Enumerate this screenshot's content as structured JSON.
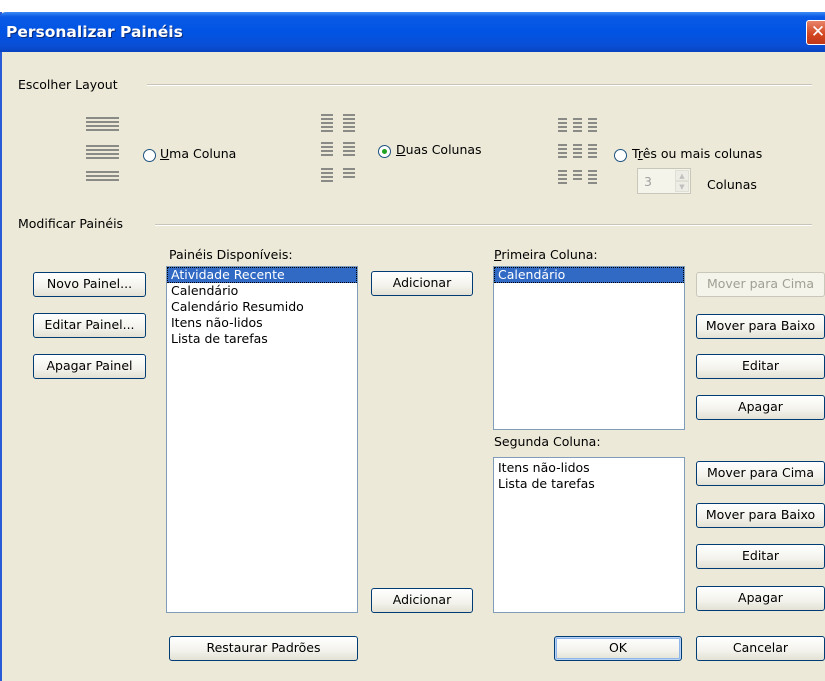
{
  "window": {
    "title": "Personalizar Painéis",
    "close_glyph": "✕"
  },
  "layout_group": {
    "label": "Escolher Layout",
    "options": [
      {
        "key": "U",
        "rest": "ma Coluna",
        "checked": false
      },
      {
        "key": "D",
        "rest": "uas Colunas",
        "checked": true
      },
      {
        "pre": "T",
        "key": "r",
        "rest": "ês ou mais colunas",
        "checked": false
      }
    ],
    "columns_spin": {
      "value": "3",
      "label": "Colunas"
    }
  },
  "panels_group": {
    "label": "Modificar Painéis",
    "left_buttons": {
      "new": "Novo Painel...",
      "edit": "Editar Painel...",
      "delete": "Apagar Painel"
    },
    "available": {
      "label": "Painéis Disponíveis:",
      "items": [
        "Atividade Recente",
        "Calendário",
        "Calendário Resumido",
        "Itens não-lidos",
        "Lista de tarefas"
      ],
      "selected_index": 0
    },
    "add_top": "Adicionar",
    "add_bottom": "Adicionar",
    "first_column": {
      "label_key": "P",
      "label_rest": "rimeira Coluna:",
      "items": [
        "Calendário"
      ],
      "selected_index": 0,
      "buttons": {
        "up": "Mover para Cima",
        "down": "Mover para Baixo",
        "edit": "Editar",
        "delete": "Apagar"
      }
    },
    "second_column": {
      "label": "Segunda Coluna:",
      "items": [
        "Itens não-lidos",
        "Lista de tarefas"
      ],
      "buttons": {
        "up": "Mover para Cima",
        "down": "Mover para Baixo",
        "edit": "Editar",
        "delete": "Apagar"
      }
    }
  },
  "footer": {
    "restore": "Restaurar Padrões",
    "ok": "OK",
    "cancel": "Cancelar"
  },
  "colors": {
    "titlebar": "#0054e3",
    "dialog_bg": "#ece9d8",
    "selection": "#316ac5",
    "checked_dot": "#21a121"
  }
}
